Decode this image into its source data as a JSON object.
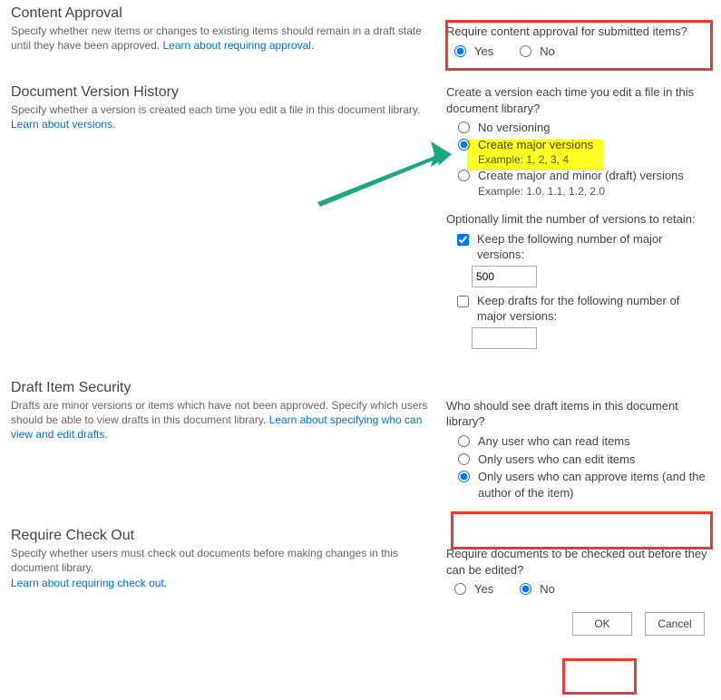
{
  "contentApproval": {
    "heading": "Content Approval",
    "desc": "Specify whether new items or changes to existing items should remain in a draft state until they have been approved.  ",
    "link": "Learn about requiring approval.",
    "q": "Require content approval for submitted items?",
    "yes": "Yes",
    "no": "No",
    "selected": "Yes",
    "annotationColor": "#e83a2e"
  },
  "versionHistory": {
    "heading": "Document Version History",
    "desc": "Specify whether a version is created each time you edit a file in this document library.  ",
    "link": "Learn about versions.",
    "q": "Create a version each time you edit a file in this document library?",
    "opt1": "No versioning",
    "opt2": "Create major versions",
    "opt2Example": "Example: 1, 2, 3, 4",
    "opt3": "Create major and minor (draft) versions",
    "opt3Example": "Example: 1.0, 1.1, 1.2, 2.0",
    "selected": "major",
    "limitLabel": "Optionally limit the number of versions to retain:",
    "keepMajorLabel": "Keep the following number of major versions:",
    "keepMajorValue": "500",
    "keepMajorChecked": true,
    "keepDraftLabel": "Keep drafts for the following number of major versions:",
    "keepDraftValue": "",
    "keepDraftChecked": false,
    "highlightColor": "#ffff00",
    "arrowColor": "#1aa781"
  },
  "draftSecurity": {
    "heading": "Draft Item Security",
    "desc": "Drafts are minor versions or items which have not been approved. Specify which users should be able to view drafts in this document library.  ",
    "link": "Learn about specifying who can view and edit drafts.",
    "q": "Who should see draft items in this document library?",
    "opt1": "Any user who can read items",
    "opt2": "Only users who can edit items",
    "opt3": "Only users who can approve items (and the author of the item)",
    "selected": "approve",
    "annotationColor": "#e83a2e"
  },
  "requireCheckOut": {
    "heading": "Require Check Out",
    "desc": "Specify whether users must check out documents before making changes in this document library.  ",
    "link": "Learn about requiring check out.",
    "q": "Require documents to be checked out before they can be edited?",
    "yes": "Yes",
    "no": "No",
    "selected": "No"
  },
  "buttons": {
    "ok": "OK",
    "cancel": "Cancel",
    "annotationColor": "#e83a2e"
  }
}
